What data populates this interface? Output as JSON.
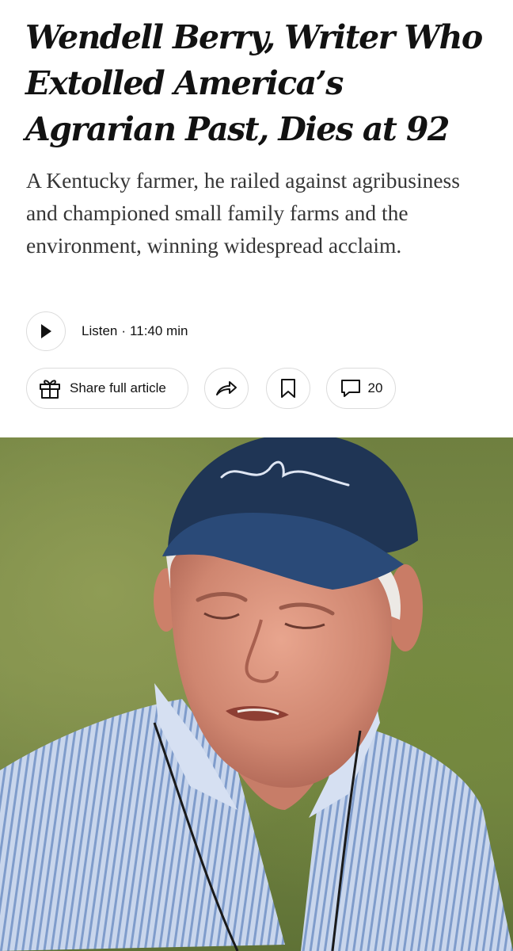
{
  "article": {
    "headline": "Wendell Berry, Writer Who Extolled America’s Agrarian Past, Dies at 92",
    "summary": "A Kentucky farmer, he railed against agribusiness and championed small family farms and the environment, winning widespread acclaim."
  },
  "audio": {
    "label": "Listen",
    "separator": "·",
    "duration": "11:40 min"
  },
  "actions": {
    "share_full": "Share full article",
    "comment_count": "20"
  },
  "icons": {
    "play": "play-icon",
    "gift": "gift-icon",
    "share": "share-arrow-icon",
    "bookmark": "bookmark-icon",
    "comment": "comment-bubble-icon"
  },
  "colors": {
    "text": "#121212",
    "summary_text": "#363636",
    "border": "#dcdcdc",
    "cap": "#1f3555"
  }
}
